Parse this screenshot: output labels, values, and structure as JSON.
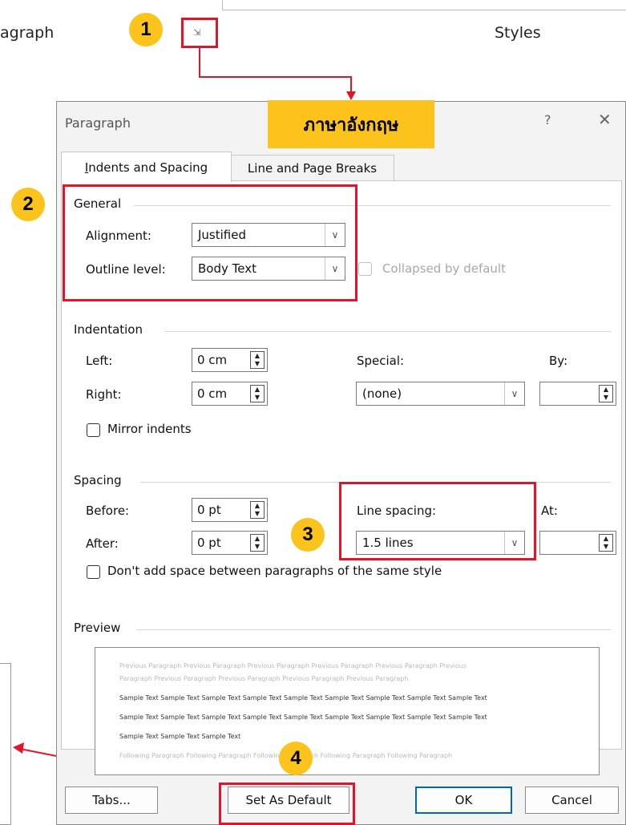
{
  "ribbon": {
    "group_left_label": "agraph",
    "group_right_label": "Styles",
    "launcher_icon": "dialog-launcher-icon"
  },
  "badges": [
    "1",
    "2",
    "3",
    "4"
  ],
  "callout": {
    "label": "ภาษาอังกฤษ"
  },
  "dialog": {
    "title": "Paragraph",
    "help_glyph": "?",
    "close_glyph": "✕",
    "tabs": [
      {
        "label": "Indents and Spacing",
        "mnemonic": "I",
        "active": true
      },
      {
        "label": "Line and Page Breaks",
        "mnemonic": "P",
        "active": false
      }
    ],
    "general": {
      "heading": "General",
      "alignment_label": "Alignment:",
      "alignment_value": "Justified",
      "outline_label": "Outline level:",
      "outline_value": "Body Text",
      "collapsed_label": "Collapsed by default"
    },
    "indentation": {
      "heading": "Indentation",
      "left_label": "Left:",
      "left_value": "0 cm",
      "right_label": "Right:",
      "right_value": "0 cm",
      "special_label": "Special:",
      "special_value": "(none)",
      "by_label": "By:",
      "by_value": "",
      "mirror_label": "Mirror indents"
    },
    "spacing": {
      "heading": "Spacing",
      "before_label": "Before:",
      "before_value": "0 pt",
      "after_label": "After:",
      "after_value": "0 pt",
      "line_spacing_label": "Line spacing:",
      "line_spacing_value": "1.5 lines",
      "at_label": "At:",
      "at_value": "",
      "dont_add_label": "Don't add space between paragraphs of the same style"
    },
    "preview": {
      "heading": "Preview",
      "lines": [
        {
          "kind": "grey",
          "text": "Previous Paragraph Previous Paragraph Previous Paragraph Previous Paragraph Previous Paragraph Previous"
        },
        {
          "kind": "grey",
          "text": "Paragraph Previous Paragraph Previous Paragraph Previous Paragraph Previous Paragraph"
        },
        {
          "kind": "dark",
          "text": "Sample Text Sample Text Sample Text Sample Text Sample Text Sample Text Sample Text Sample Text Sample Text"
        },
        {
          "kind": "dark",
          "text": "Sample Text Sample Text Sample Text Sample Text Sample Text Sample Text Sample Text Sample Text Sample Text"
        },
        {
          "kind": "dark",
          "text": "Sample Text Sample Text Sample Text"
        },
        {
          "kind": "grey",
          "text": "Following Paragraph Following Paragraph Following Paragraph Following Paragraph Following Paragraph"
        }
      ]
    },
    "buttons": {
      "tabs": "Tabs...",
      "set_default": "Set As Default",
      "ok": "OK",
      "cancel": "Cancel"
    }
  },
  "colors": {
    "badge": "#fbc31b",
    "highlight": "#e3142a",
    "primary_border": "#0067c0"
  }
}
